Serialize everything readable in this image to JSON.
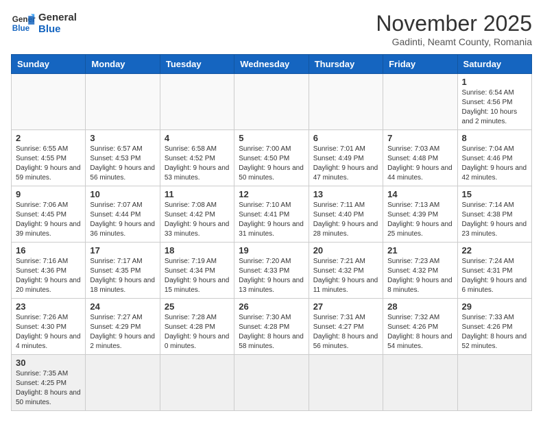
{
  "logo": {
    "line1": "General",
    "line2": "Blue"
  },
  "title": "November 2025",
  "subtitle": "Gadinti, Neamt County, Romania",
  "days_of_week": [
    "Sunday",
    "Monday",
    "Tuesday",
    "Wednesday",
    "Thursday",
    "Friday",
    "Saturday"
  ],
  "weeks": [
    [
      {
        "day": "",
        "info": ""
      },
      {
        "day": "",
        "info": ""
      },
      {
        "day": "",
        "info": ""
      },
      {
        "day": "",
        "info": ""
      },
      {
        "day": "",
        "info": ""
      },
      {
        "day": "",
        "info": ""
      },
      {
        "day": "1",
        "info": "Sunrise: 6:54 AM\nSunset: 4:56 PM\nDaylight: 10 hours and 2 minutes."
      }
    ],
    [
      {
        "day": "2",
        "info": "Sunrise: 6:55 AM\nSunset: 4:55 PM\nDaylight: 9 hours and 59 minutes."
      },
      {
        "day": "3",
        "info": "Sunrise: 6:57 AM\nSunset: 4:53 PM\nDaylight: 9 hours and 56 minutes."
      },
      {
        "day": "4",
        "info": "Sunrise: 6:58 AM\nSunset: 4:52 PM\nDaylight: 9 hours and 53 minutes."
      },
      {
        "day": "5",
        "info": "Sunrise: 7:00 AM\nSunset: 4:50 PM\nDaylight: 9 hours and 50 minutes."
      },
      {
        "day": "6",
        "info": "Sunrise: 7:01 AM\nSunset: 4:49 PM\nDaylight: 9 hours and 47 minutes."
      },
      {
        "day": "7",
        "info": "Sunrise: 7:03 AM\nSunset: 4:48 PM\nDaylight: 9 hours and 44 minutes."
      },
      {
        "day": "8",
        "info": "Sunrise: 7:04 AM\nSunset: 4:46 PM\nDaylight: 9 hours and 42 minutes."
      }
    ],
    [
      {
        "day": "9",
        "info": "Sunrise: 7:06 AM\nSunset: 4:45 PM\nDaylight: 9 hours and 39 minutes."
      },
      {
        "day": "10",
        "info": "Sunrise: 7:07 AM\nSunset: 4:44 PM\nDaylight: 9 hours and 36 minutes."
      },
      {
        "day": "11",
        "info": "Sunrise: 7:08 AM\nSunset: 4:42 PM\nDaylight: 9 hours and 33 minutes."
      },
      {
        "day": "12",
        "info": "Sunrise: 7:10 AM\nSunset: 4:41 PM\nDaylight: 9 hours and 31 minutes."
      },
      {
        "day": "13",
        "info": "Sunrise: 7:11 AM\nSunset: 4:40 PM\nDaylight: 9 hours and 28 minutes."
      },
      {
        "day": "14",
        "info": "Sunrise: 7:13 AM\nSunset: 4:39 PM\nDaylight: 9 hours and 25 minutes."
      },
      {
        "day": "15",
        "info": "Sunrise: 7:14 AM\nSunset: 4:38 PM\nDaylight: 9 hours and 23 minutes."
      }
    ],
    [
      {
        "day": "16",
        "info": "Sunrise: 7:16 AM\nSunset: 4:36 PM\nDaylight: 9 hours and 20 minutes."
      },
      {
        "day": "17",
        "info": "Sunrise: 7:17 AM\nSunset: 4:35 PM\nDaylight: 9 hours and 18 minutes."
      },
      {
        "day": "18",
        "info": "Sunrise: 7:19 AM\nSunset: 4:34 PM\nDaylight: 9 hours and 15 minutes."
      },
      {
        "day": "19",
        "info": "Sunrise: 7:20 AM\nSunset: 4:33 PM\nDaylight: 9 hours and 13 minutes."
      },
      {
        "day": "20",
        "info": "Sunrise: 7:21 AM\nSunset: 4:32 PM\nDaylight: 9 hours and 11 minutes."
      },
      {
        "day": "21",
        "info": "Sunrise: 7:23 AM\nSunset: 4:32 PM\nDaylight: 9 hours and 8 minutes."
      },
      {
        "day": "22",
        "info": "Sunrise: 7:24 AM\nSunset: 4:31 PM\nDaylight: 9 hours and 6 minutes."
      }
    ],
    [
      {
        "day": "23",
        "info": "Sunrise: 7:26 AM\nSunset: 4:30 PM\nDaylight: 9 hours and 4 minutes."
      },
      {
        "day": "24",
        "info": "Sunrise: 7:27 AM\nSunset: 4:29 PM\nDaylight: 9 hours and 2 minutes."
      },
      {
        "day": "25",
        "info": "Sunrise: 7:28 AM\nSunset: 4:28 PM\nDaylight: 9 hours and 0 minutes."
      },
      {
        "day": "26",
        "info": "Sunrise: 7:30 AM\nSunset: 4:28 PM\nDaylight: 8 hours and 58 minutes."
      },
      {
        "day": "27",
        "info": "Sunrise: 7:31 AM\nSunset: 4:27 PM\nDaylight: 8 hours and 56 minutes."
      },
      {
        "day": "28",
        "info": "Sunrise: 7:32 AM\nSunset: 4:26 PM\nDaylight: 8 hours and 54 minutes."
      },
      {
        "day": "29",
        "info": "Sunrise: 7:33 AM\nSunset: 4:26 PM\nDaylight: 8 hours and 52 minutes."
      }
    ],
    [
      {
        "day": "30",
        "info": "Sunrise: 7:35 AM\nSunset: 4:25 PM\nDaylight: 8 hours and 50 minutes."
      },
      {
        "day": "",
        "info": ""
      },
      {
        "day": "",
        "info": ""
      },
      {
        "day": "",
        "info": ""
      },
      {
        "day": "",
        "info": ""
      },
      {
        "day": "",
        "info": ""
      },
      {
        "day": "",
        "info": ""
      }
    ]
  ]
}
